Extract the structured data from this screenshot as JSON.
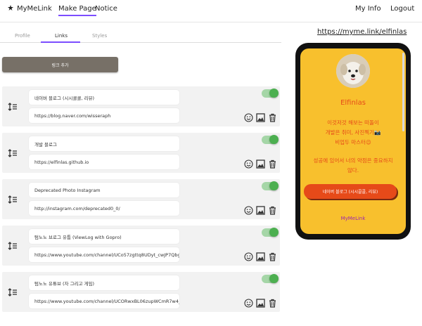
{
  "nav": {
    "brand": "MyMeLink",
    "make_page": "Make Page",
    "notice": "Notice",
    "my_info": "My Info",
    "logout": "Logout",
    "accent": "#7c4dff"
  },
  "tabs": [
    "Profile",
    "Links",
    "Styles"
  ],
  "active_tab": "Links",
  "add_link_button": "링크 추가",
  "links": [
    {
      "title": "네이버 블로그 (시시콜콜, 리뷰)",
      "url": "https://blog.naver.com/wisseraph",
      "enabled": true
    },
    {
      "title": "개발 블로그",
      "url": "https://elfinlas.github.io",
      "enabled": true
    },
    {
      "title": "Deprecated Photo Instagram",
      "url": "http://instagram.com/deprecated0_0/",
      "enabled": true
    },
    {
      "title": "텀노노 브로그 유튭 (ViewLog with Gopro)",
      "url": "https://www.youtube.com/channel/UCo57zgttq8UDyt_cwJP7Qbg",
      "enabled": true
    },
    {
      "title": "텀노노 유튜브 (자 그리고 게임)",
      "url": "https://www.youtube.com/channel/UCORwxBL06zupWCmR7w4_",
      "enabled": true
    }
  ],
  "preview": {
    "url": "https://myme.link/elfinlas",
    "name": "Elfinlas",
    "bio_lines": [
      "이것저것 해보는 떠돌이",
      "개발은 취미, 사진찍기📸",
      "비업두 마스터😉"
    ],
    "bio_lines2": [
      "성공에 있어서 너의 약점은 중요하지",
      "않다."
    ],
    "link_button": "네이버 블로그 (시시콜콜, 리뷰)",
    "footer": "MyMeLink",
    "background": "#f8c02d",
    "accent": "#e64a19"
  }
}
